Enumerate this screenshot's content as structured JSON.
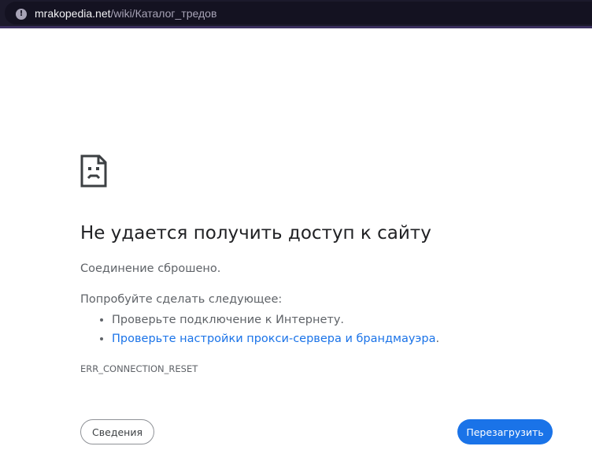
{
  "browser": {
    "url_domain": "mrakopedia.net",
    "url_path": "/wiki/Каталог_тредов",
    "info_icon_glyph": "!"
  },
  "error_page": {
    "icon": "sad-document-icon",
    "title": "Не удается получить доступ к сайту",
    "reason": "Соединение сброшено.",
    "try_label": "Попробуйте сделать следующее:",
    "suggestions": [
      "Проверьте подключение к Интернету.",
      "Проверьте настройки прокси-сервера и брандмауэра"
    ],
    "suggestion_link_suffix": ".",
    "error_code": "ERR_CONNECTION_RESET",
    "details_button": "Сведения",
    "reload_button": "Перезагрузить"
  },
  "colors": {
    "link": "#1a73e8",
    "reload_button_bg": "#1a73e8",
    "body_text": "#5f6368",
    "title_text": "#202124",
    "url_bar_bg": "#1c1a2b"
  }
}
